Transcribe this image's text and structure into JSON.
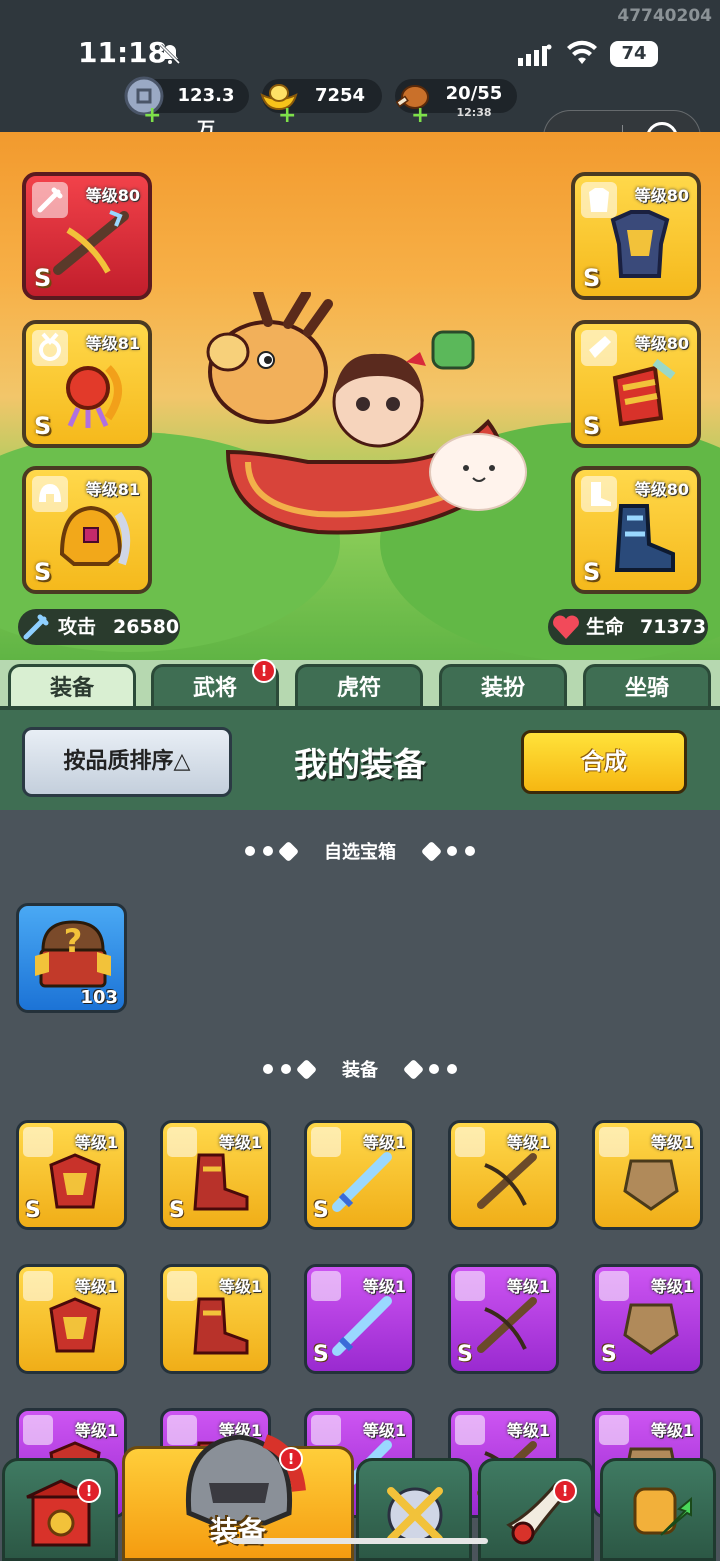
{
  "status_bar": {
    "uid": "47740204",
    "time": "11:18",
    "battery": "74"
  },
  "resources": {
    "silver": "123.3万",
    "gold": "7254",
    "stamina": "20/55",
    "stamina_timer": "12:38"
  },
  "equipped": {
    "left": [
      {
        "level": "等级80",
        "grade": "S",
        "slot_icon": "sword-icon"
      },
      {
        "level": "等级81",
        "grade": "S",
        "slot_icon": "medal-icon"
      },
      {
        "level": "等级81",
        "grade": "S",
        "slot_icon": "helmet-icon"
      }
    ],
    "right": [
      {
        "level": "等级80",
        "grade": "S",
        "slot_icon": "armor-icon"
      },
      {
        "level": "等级80",
        "grade": "S",
        "slot_icon": "bracer-icon"
      },
      {
        "level": "等级80",
        "grade": "S",
        "slot_icon": "boot-icon"
      }
    ]
  },
  "stats": {
    "attack_label": "攻击",
    "attack_value": "26580",
    "hp_label": "生命",
    "hp_value": "71373"
  },
  "tabs": [
    {
      "label": "装备",
      "active": true
    },
    {
      "label": "武将",
      "badge": "!"
    },
    {
      "label": "虎符"
    },
    {
      "label": "装扮"
    },
    {
      "label": "坐骑"
    }
  ],
  "header": {
    "sort_label": "按品质排序",
    "title": "我的装备",
    "merge_label": "合成"
  },
  "sections": {
    "chest_title": "自选宝箱",
    "equip_title": "装备"
  },
  "chest": {
    "count": "103"
  },
  "items": [
    {
      "level": "等级1",
      "grade": "S",
      "color": "gold"
    },
    {
      "level": "等级1",
      "grade": "S",
      "color": "gold"
    },
    {
      "level": "等级1",
      "grade": "S",
      "color": "gold"
    },
    {
      "level": "等级1",
      "grade": "",
      "color": "gold"
    },
    {
      "level": "等级1",
      "grade": "",
      "color": "gold"
    },
    {
      "level": "等级1",
      "grade": "",
      "color": "gold"
    },
    {
      "level": "等级1",
      "grade": "",
      "color": "gold"
    },
    {
      "level": "等级1",
      "grade": "S",
      "color": "purple"
    },
    {
      "level": "等级1",
      "grade": "S",
      "color": "purple"
    },
    {
      "level": "等级1",
      "grade": "S",
      "color": "purple"
    },
    {
      "level": "等级1",
      "grade": "",
      "color": "purple"
    },
    {
      "level": "等级1",
      "grade": "",
      "color": "purple"
    },
    {
      "level": "等级1",
      "grade": "",
      "color": "purple"
    },
    {
      "level": "等级1",
      "grade": "",
      "color": "purple"
    },
    {
      "level": "等级1",
      "grade": "",
      "color": "purple"
    }
  ],
  "bottom_nav": {
    "active_label": "装备",
    "badge": "!"
  },
  "colors": {
    "scene_top": "#f29a2e",
    "panel_green": "#3f6e53",
    "list_bg": "#4b545b",
    "rarity_gold": "#f5b91c",
    "rarity_purple": "#b23fe0"
  }
}
